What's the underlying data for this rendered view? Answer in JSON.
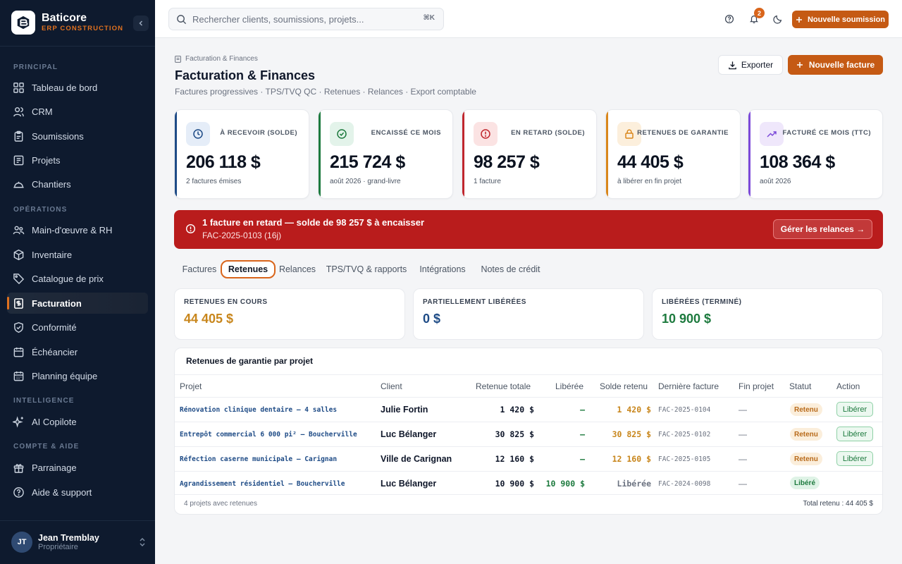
{
  "brand": {
    "name": "Baticore",
    "subtitle": "ERP CONSTRUCTION"
  },
  "sidebar": {
    "sections": [
      {
        "label": "PRINCIPAL",
        "items": [
          {
            "label": "Tableau de bord",
            "icon": "grid-icon"
          },
          {
            "label": "CRM",
            "icon": "users-icon"
          },
          {
            "label": "Soumissions",
            "icon": "clipboard-icon"
          },
          {
            "label": "Projets",
            "icon": "folder-icon"
          },
          {
            "label": "Chantiers",
            "icon": "helmet-icon"
          }
        ]
      },
      {
        "label": "OPÉRATIONS",
        "items": [
          {
            "label": "Main-d'œuvre & RH",
            "icon": "user-group-icon"
          },
          {
            "label": "Inventaire",
            "icon": "box-icon"
          },
          {
            "label": "Catalogue de prix",
            "icon": "tag-icon"
          },
          {
            "label": "Facturation",
            "icon": "invoice-icon",
            "active": true
          },
          {
            "label": "Conformité",
            "icon": "shield-check-icon"
          },
          {
            "label": "Échéancier",
            "icon": "calendar-icon"
          },
          {
            "label": "Planning équipe",
            "icon": "calendar-grid-icon"
          }
        ]
      },
      {
        "label": "INTELLIGENCE",
        "items": [
          {
            "label": "AI Copilote",
            "icon": "sparkles-icon"
          }
        ]
      },
      {
        "label": "COMPTE & AIDE",
        "items": [
          {
            "label": "Parrainage",
            "icon": "gift-icon"
          },
          {
            "label": "Aide & support",
            "icon": "help-circle-icon"
          }
        ]
      }
    ],
    "user": {
      "initials": "JT",
      "name": "Jean Tremblay",
      "role": "Propriétaire"
    }
  },
  "topbar": {
    "search_placeholder": "Rechercher clients, soumissions, projets...",
    "shortcut": "⌘K",
    "notifications_count": "2",
    "new_quote": "Nouvelle soumission"
  },
  "header": {
    "breadcrumb": "Facturation & Finances",
    "title": "Facturation & Finances",
    "subtitle": "Factures progressives · TPS/TVQ QC · Retenues · Relances · Export comptable",
    "export_label": "Exporter",
    "new_invoice_label": "Nouvelle facture"
  },
  "kpis": [
    {
      "label": "À RECEVOIR (SOLDE)",
      "value": "206 118 $",
      "foot": "2 factures émises",
      "color": "#1e4b86",
      "bg": "#e5edf8",
      "icon": "clock-icon"
    },
    {
      "label": "ENCAISSÉ CE MOIS",
      "value": "215 724 $",
      "foot": "août 2026 · grand-livre",
      "color": "#1d7a3e",
      "bg": "#e3f3ea",
      "icon": "check-circle-icon"
    },
    {
      "label": "EN RETARD (SOLDE)",
      "value": "98 257 $",
      "foot": "1 facture",
      "color": "#c0262d",
      "bg": "#fbe3e3",
      "icon": "alert-circle-icon"
    },
    {
      "label": "RETENUES DE GARANTIE",
      "value": "44 405 $",
      "foot": "à libérer en fin projet",
      "color": "#d9861b",
      "bg": "#fcefdc",
      "icon": "lock-icon"
    },
    {
      "label": "FACTURÉ CE MOIS (TTC)",
      "value": "108 364 $",
      "foot": "août 2026",
      "color": "#7c4ad9",
      "bg": "#efe7fb",
      "icon": "trending-up-icon"
    }
  ],
  "alert": {
    "title": "1 facture en retard — solde de 98 257 $ à encaisser",
    "subtitle": "FAC-2025-0103 (16j)",
    "button": "Gérer les relances →"
  },
  "tabs": [
    "Factures",
    "Retenues",
    "Relances",
    "TPS/TVQ & rapports",
    "Intégrations",
    "Notes de crédit"
  ],
  "active_tab": "Retenues",
  "retention_summary": [
    {
      "label": "RETENUES EN COURS",
      "value": "44 405 $",
      "color": "#c8861c"
    },
    {
      "label": "PARTIELLEMENT LIBÉRÉES",
      "value": "0 $",
      "color": "#1e4b86"
    },
    {
      "label": "LIBÉRÉES (TERMINÉ)",
      "value": "10 900 $",
      "color": "#1d7a3e"
    }
  ],
  "table": {
    "title": "Retenues de garantie par projet",
    "columns": [
      "Projet",
      "Client",
      "Retenue totale",
      "Libérée",
      "Solde retenu",
      "Dernière facture",
      "Fin projet",
      "Statut",
      "Action"
    ],
    "rows": [
      {
        "project": "Rénovation clinique dentaire — 4 salles",
        "client": "Julie Fortin",
        "total": "1 420 $",
        "released": "—",
        "balance": "1 420 $",
        "last_invoice": "FAC-2025-0104",
        "end": "—",
        "status": "Retenu",
        "action": "Libérer"
      },
      {
        "project": "Entrepôt commercial 6 000 pi² — Boucherville",
        "client": "Luc Bélanger",
        "total": "30 825 $",
        "released": "—",
        "balance": "30 825 $",
        "last_invoice": "FAC-2025-0102",
        "end": "—",
        "status": "Retenu",
        "action": "Libérer"
      },
      {
        "project": "Réfection caserne municipale — Carignan",
        "client": "Ville de Carignan",
        "total": "12 160 $",
        "released": "—",
        "balance": "12 160 $",
        "last_invoice": "FAC-2025-0105",
        "end": "—",
        "status": "Retenu",
        "action": "Libérer"
      },
      {
        "project": "Agrandissement résidentiel — Boucherville",
        "client": "Luc Bélanger",
        "total": "10 900 $",
        "released": "10 900 $",
        "balance": "Libérée",
        "last_invoice": "FAC-2024-0098",
        "end": "—",
        "status": "Libéré",
        "action": ""
      }
    ],
    "footer_left": "4 projets avec retenues",
    "footer_right": "Total retenu : 44 405 $"
  }
}
